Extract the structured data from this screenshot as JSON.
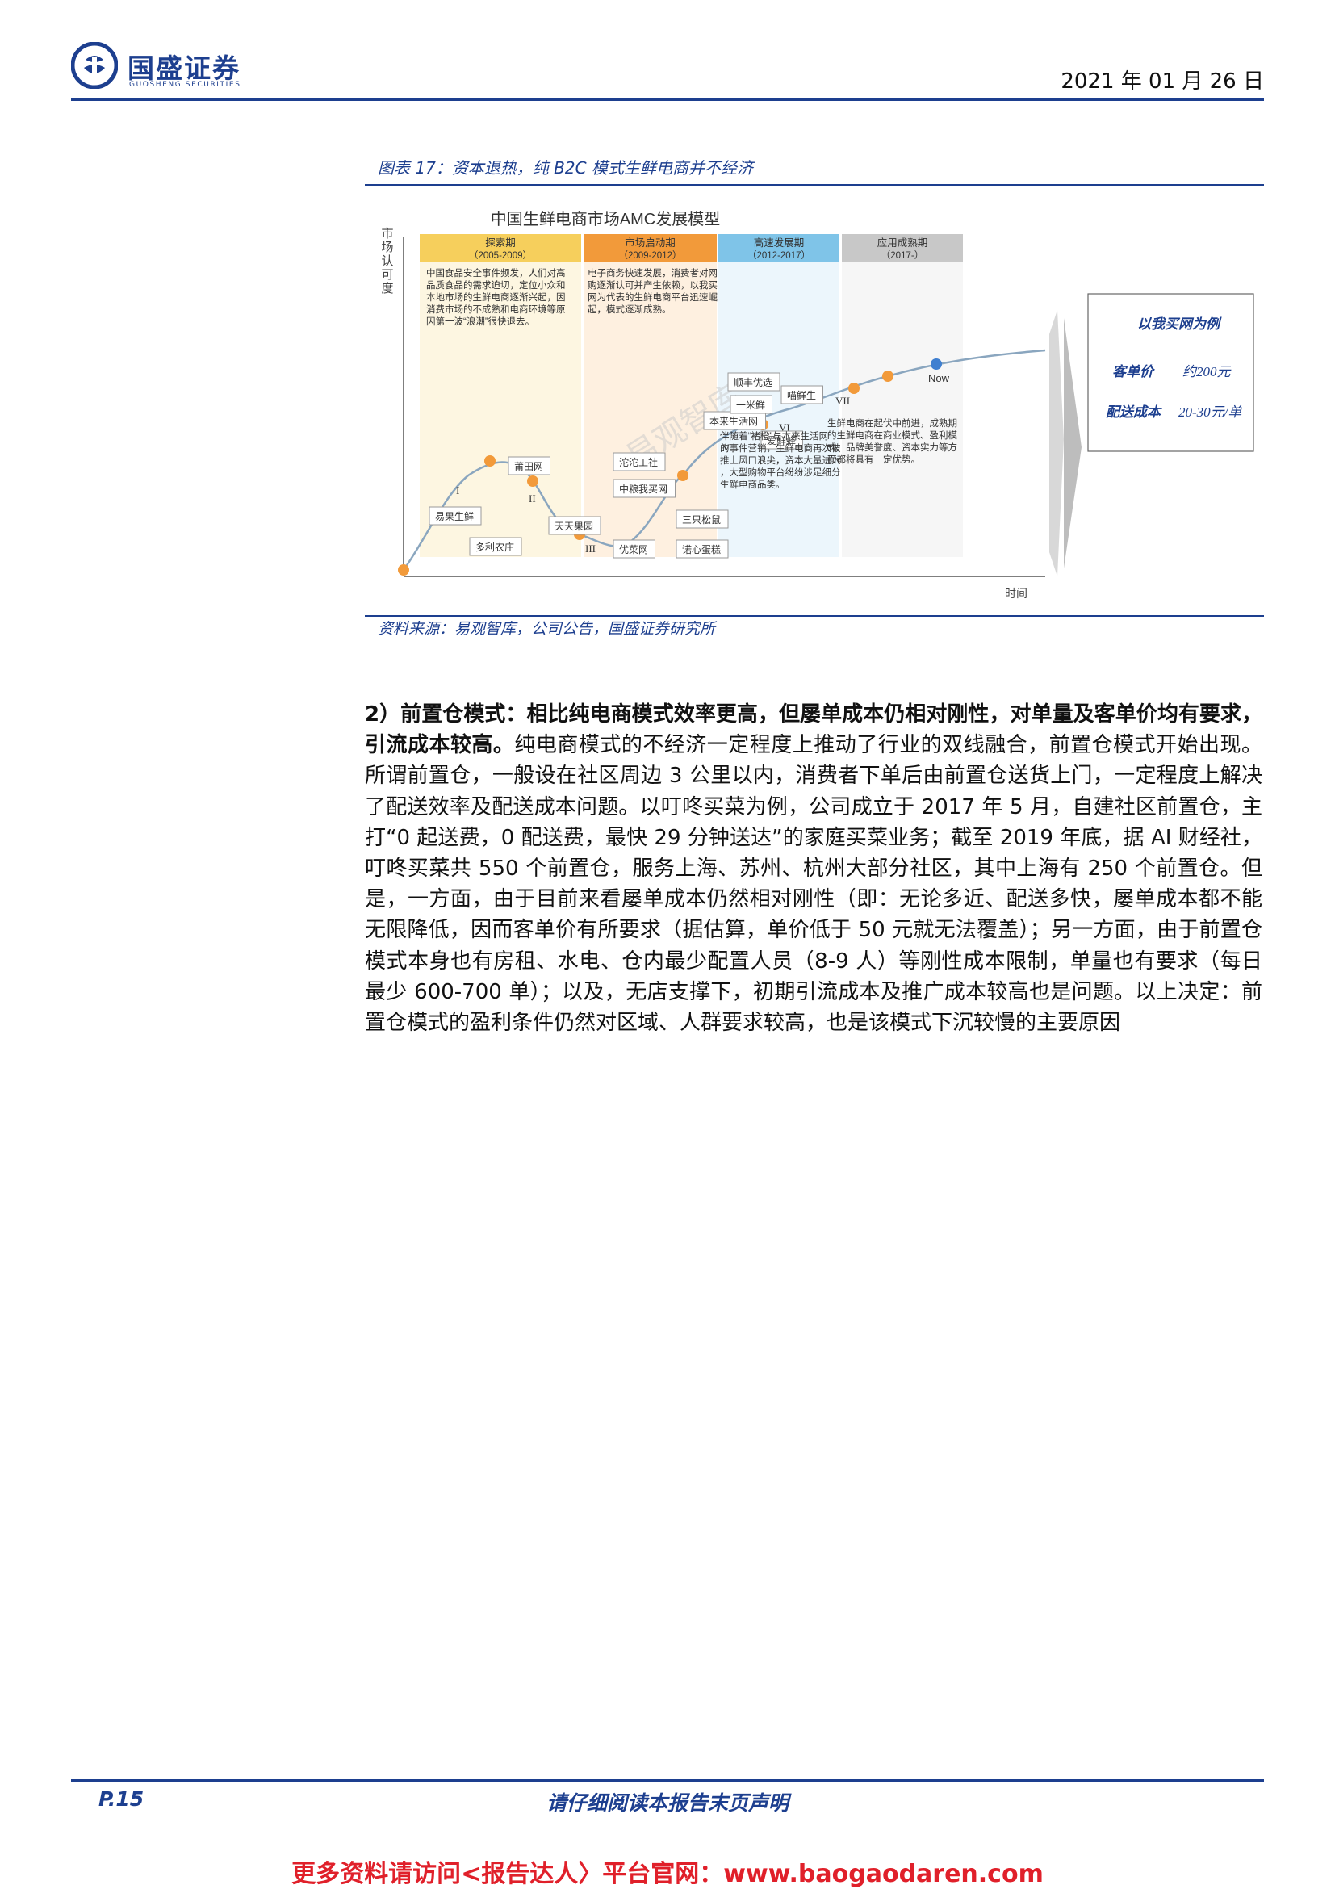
{
  "header": {
    "brand_cn": "国盛证券",
    "brand_en": "GUOSHENG SECURITIES",
    "date": "2021 年 01 月 26 日",
    "brand_color": "#1d3f8f"
  },
  "figure": {
    "caption": "图表 17：资本退热，纯 B2C 模式生鲜电商并不经济",
    "title": "中国生鲜电商市场AMC发展模型",
    "y_axis_label": "市场认可度",
    "x_axis_label": "时间",
    "watermark": "易观智库",
    "stages": [
      {
        "name": "探索期",
        "years": "（2005-2009）",
        "color": "#f6cf5c",
        "bg": "#fcefc8",
        "desc": "中国食品安全事件频发，人们对高品质食品的需求迫切，定位小众和本地市场的生鲜电商逐渐兴起，因消费市场的不成熟和电商环境等原因第一波“浪潮”很快退去。"
      },
      {
        "name": "市场启动期",
        "years": "（2009-2012）",
        "color": "#f29a3a",
        "bg": "#fde3c7",
        "desc": "电子商务快速发展，消费者对网购逐渐认可并产生依赖，以我买网为代表的生鲜电商平台迅速崛起，模式逐渐成熟。"
      },
      {
        "name": "高速发展期",
        "years": "（2012-2017）",
        "color": "#7fc4e8",
        "bg": "#dcefFa",
        "desc": "伴随着“褚橙”与本来生活网的事件营销，生鲜电商再次被推上风口浪尖，资本大量进入，大型购物平台纷纷涉足细分生鲜电商品类。"
      },
      {
        "name": "应用成熟期",
        "years": "（2017-）",
        "color": "#c8c8c8",
        "bg": "#efefef",
        "desc": "生鲜电商在起伏中前进，成熟期的生鲜电商在商业模式、盈利模式、品牌美誉度、资本实力等方面都将具有一定优势。"
      }
    ],
    "phases": [
      "I",
      "II",
      "III",
      "IV",
      "V",
      "VI",
      "VII"
    ],
    "now_label": "Now",
    "companies": [
      "易果生鲜",
      "多利农庄",
      "莆田网",
      "天天果园",
      "沱沱工社",
      "中粮我买网",
      "优菜网",
      "三只松鼠",
      "诺心蛋糕",
      "本来生活网",
      "顺丰优选",
      "一米鲜",
      "喵鲜生",
      "爱鲜蜂"
    ],
    "callout": {
      "title": "以我买网为例",
      "rows": [
        {
          "label": "客单价",
          "value": "约200元"
        },
        {
          "label": "配送成本",
          "value": "20-30元/单"
        }
      ]
    },
    "source": "资料来源：易观智库，公司公告，国盛证券研究所"
  },
  "body": {
    "heading_bold": "2）前置仓模式：相比纯电商模式效率更高，但屡单成本仍相对刚性，对单量及客单价均有要求，引流成本较高。",
    "text": "纯电商模式的不经济一定程度上推动了行业的双线融合，前置仓模式开始出现。所谓前置仓，一般设在社区周边 3 公里以内，消费者下单后由前置仓送货上门，一定程度上解决了配送效率及配送成本问题。以叮咚买菜为例，公司成立于 2017 年 5 月，自建社区前置仓，主打“0 起送费，0 配送费，最快 29 分钟送达”的家庭买菜业务；截至 2019 年底，据 AI 财经社，叮咚买菜共 550 个前置仓，服务上海、苏州、杭州大部分社区，其中上海有 250 个前置仓。但是，一方面，由于目前来看屡单成本仍然相对刚性（即：无论多近、配送多快，屡单成本都不能无限降低，因而客单价有所要求（据估算，单价低于 50 元就无法覆盖）；另一方面，由于前置仓模式本身也有房租、水电、仓内最少配置人员（8-9 人）等刚性成本限制，单量也有要求（每日最少 600-700 单）；以及，无店支撑下，初期引流成本及推广成本较高也是问题。以上决定：前置仓模式的盈利条件仍然对区域、人群要求较高，也是该模式下沉较慢的主要原因"
  },
  "footer": {
    "page": "P.15",
    "disclaimer": "请仔细阅读本报告末页声明",
    "promo": "更多资料请访问<报告达人〉平台官网：www.baogaodaren.com"
  }
}
